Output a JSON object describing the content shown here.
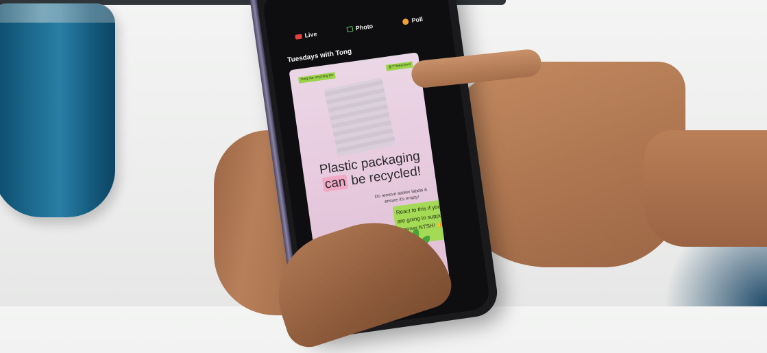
{
  "screen": {
    "actions": [
      {
        "label": "Live",
        "icon": "live-video-icon"
      },
      {
        "label": "Photo",
        "icon": "photo-icon"
      },
      {
        "label": "Poll",
        "icon": "poll-icon"
      }
    ],
    "story_title": "Tuesdays with Tong",
    "card": {
      "tag_left": "Tong the recycling bin",
      "tag_right": "@TTtheschool",
      "headline_line1": "Plastic packaging",
      "headline_highlight": "can",
      "headline_rest": "be recycled!",
      "subnote": "Do remove sticker labels & ensure it's empty!",
      "green_note": "React to this if you are going to support a greener NTSH! 👍❤️😮"
    }
  },
  "colors": {
    "accent_green": "#9bd34a",
    "card_pink": "#e7c9de",
    "cup_blue": "#1e6d92",
    "live_red": "#e5413c"
  }
}
